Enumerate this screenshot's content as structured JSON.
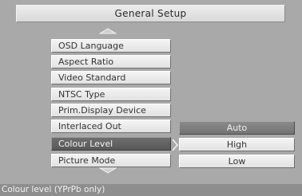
{
  "header": {
    "title": "General Setup"
  },
  "menu": {
    "items": [
      {
        "label": "OSD Language",
        "selected": false
      },
      {
        "label": "Aspect Ratio",
        "selected": false
      },
      {
        "label": "Video Standard",
        "selected": false
      },
      {
        "label": "NTSC Type",
        "selected": false
      },
      {
        "label": "Prim.Display Device",
        "selected": false
      },
      {
        "label": "Interlaced Out",
        "selected": false
      },
      {
        "label": "Colour Level",
        "selected": true
      },
      {
        "label": "Picture Mode",
        "selected": false
      }
    ],
    "scroll_up_icon": "triangle-up-icon",
    "scroll_down_icon": "triangle-down-icon",
    "submenu_indicator_icon": "chevron-right-icon"
  },
  "options": {
    "items": [
      {
        "label": "Auto",
        "highlighted": true
      },
      {
        "label": "High",
        "highlighted": false
      },
      {
        "label": "Low",
        "highlighted": false
      }
    ]
  },
  "status": {
    "text": "Colour level (YPrPb only)"
  }
}
